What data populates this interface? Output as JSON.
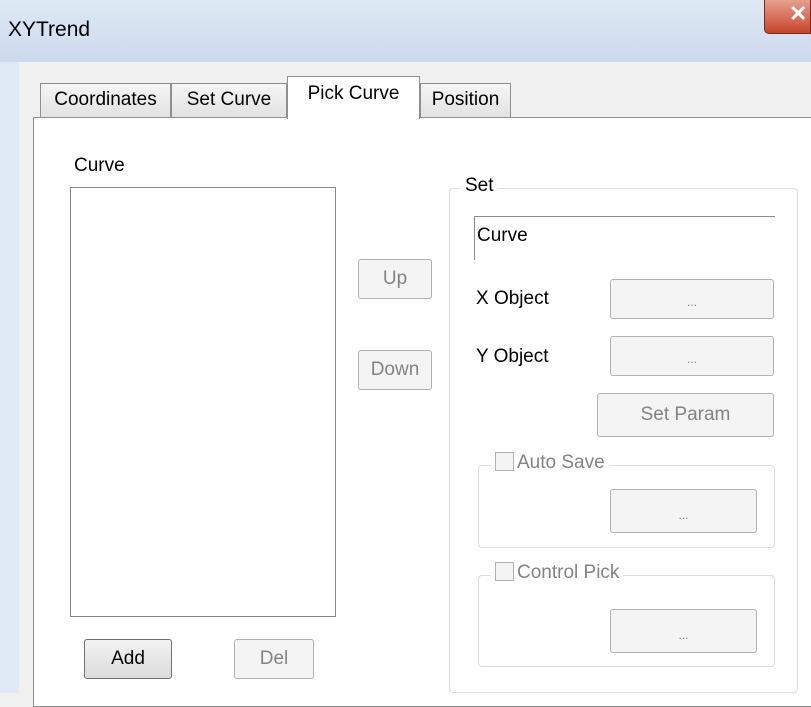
{
  "window": {
    "title": "XYTrend",
    "close_symbol": "✕"
  },
  "tabs": [
    {
      "label": "Coordinates"
    },
    {
      "label": "Set Curve"
    },
    {
      "label": "Pick Curve"
    },
    {
      "label": "Position"
    }
  ],
  "curve_list": {
    "label": "Curve"
  },
  "buttons": {
    "up": "Up",
    "down": "Down",
    "add": "Add",
    "del": "Del"
  },
  "set_group": {
    "legend": "Set",
    "curve_field_value": "Curve",
    "x_object_label": "X Object",
    "x_object_button": "...",
    "y_object_label": "Y Object",
    "y_object_button": "...",
    "set_param_button": "Set Param"
  },
  "auto_save": {
    "label": "Auto Save",
    "checked": false,
    "button": "..."
  },
  "control_pick": {
    "label": "Control Pick",
    "checked": false,
    "button": "..."
  }
}
